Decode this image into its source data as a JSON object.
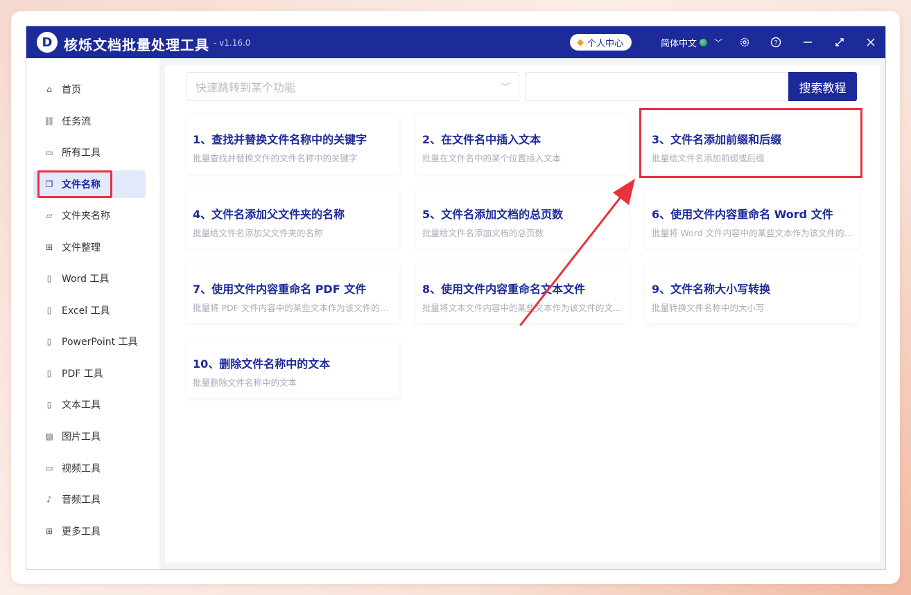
{
  "app": {
    "logo_letter": "D",
    "title": "核烁文档批量处理工具",
    "version": "- v1.16.0",
    "user_center": "个人中心",
    "language": "简体中文"
  },
  "sidebar": {
    "items": [
      {
        "label": "首页",
        "icon": "home-icon"
      },
      {
        "label": "任务流",
        "icon": "workflow-icon"
      },
      {
        "label": "所有工具",
        "icon": "monitor-icon"
      },
      {
        "label": "文件名称",
        "icon": "file-copy-icon"
      },
      {
        "label": "文件夹名称",
        "icon": "folder-icon"
      },
      {
        "label": "文件整理",
        "icon": "organize-icon"
      },
      {
        "label": "Word 工具",
        "icon": "word-file-icon"
      },
      {
        "label": "Excel 工具",
        "icon": "excel-file-icon"
      },
      {
        "label": "PowerPoint 工具",
        "icon": "ppt-file-icon"
      },
      {
        "label": "PDF 工具",
        "icon": "pdf-file-icon"
      },
      {
        "label": "文本工具",
        "icon": "text-file-icon"
      },
      {
        "label": "图片工具",
        "icon": "image-icon"
      },
      {
        "label": "视频工具",
        "icon": "video-icon"
      },
      {
        "label": "音频工具",
        "icon": "microphone-icon"
      },
      {
        "label": "更多工具",
        "icon": "grid-icon"
      }
    ],
    "active_index": 3
  },
  "search": {
    "jump_placeholder": "快速跳转到某个功能",
    "input_value": "",
    "button_label": "搜索教程"
  },
  "cards": [
    {
      "title": "1、查找并替换文件名称中的关键字",
      "desc": "批量查找并替换文件的文件名称中的关键字"
    },
    {
      "title": "2、在文件名中插入文本",
      "desc": "批量在文件名中的某个位置插入文本"
    },
    {
      "title": "3、文件名添加前缀和后缀",
      "desc": "批量给文件名添加前缀或后缀"
    },
    {
      "title": "4、文件名添加父文件夹的名称",
      "desc": "批量给文件名添加父文件夹的名称"
    },
    {
      "title": "5、文件名添加文档的总页数",
      "desc": "批量给文件名添加文档的总页数"
    },
    {
      "title": "6、使用文件内容重命名 Word 文件",
      "desc": "批量将 Word 文件内容中的某些文本作为该文件的..."
    },
    {
      "title": "7、使用文件内容重命名 PDF 文件",
      "desc": "批量将 PDF 文件内容中的某些文本作为该文件的文..."
    },
    {
      "title": "8、使用文件内容重命名文本文件",
      "desc": "批量将文本文件内容中的某些文本作为该文件的文..."
    },
    {
      "title": "9、文件名称大小写转换",
      "desc": "批量转换文件名称中的大小写"
    },
    {
      "title": "10、删除文件名称中的文本",
      "desc": "批量删除文件名称中的文本"
    }
  ],
  "colors": {
    "brand": "#1d2a99",
    "annotation": "#e8323c"
  }
}
